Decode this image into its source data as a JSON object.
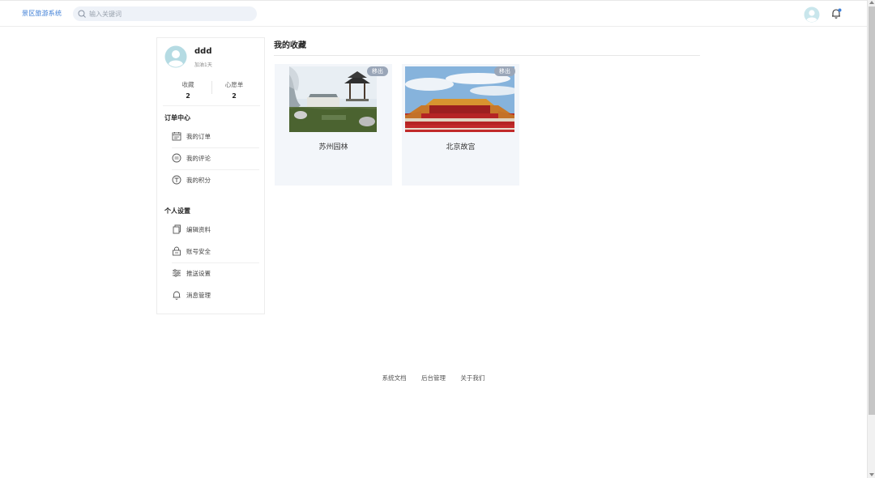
{
  "header": {
    "brand": "景区旅游系统",
    "search_placeholder": "输入关键词"
  },
  "sidebar": {
    "username": "ddd",
    "subtext": "加油1天",
    "stats": [
      {
        "label": "收藏",
        "value": "2"
      },
      {
        "label": "心愿单",
        "value": "2"
      }
    ],
    "order_section": {
      "title": "订单中心",
      "items": [
        {
          "label": "我的订单",
          "icon": "calendar-icon"
        },
        {
          "label": "我的评论",
          "icon": "comment-icon"
        },
        {
          "label": "我的积分",
          "icon": "points-icon"
        }
      ]
    },
    "settings_section": {
      "title": "个人设置",
      "items": [
        {
          "label": "编辑资料",
          "icon": "copy-icon"
        },
        {
          "label": "账号安全",
          "icon": "lock-icon"
        },
        {
          "label": "推送设置",
          "icon": "sliders-icon"
        },
        {
          "label": "消息管理",
          "icon": "bell-icon"
        }
      ]
    }
  },
  "main": {
    "title": "我的收藏",
    "cards": [
      {
        "name": "苏州园林",
        "remove_label": "移出"
      },
      {
        "name": "北京故宫",
        "remove_label": "移出"
      }
    ]
  },
  "footer": {
    "links": [
      "系统文档",
      "后台管理",
      "关于我们"
    ]
  },
  "colors": {
    "brand": "#3d7ed6",
    "avatar": "#b5dbe3",
    "card_bg": "#f3f6fa",
    "badge": "#9aa6b8"
  }
}
